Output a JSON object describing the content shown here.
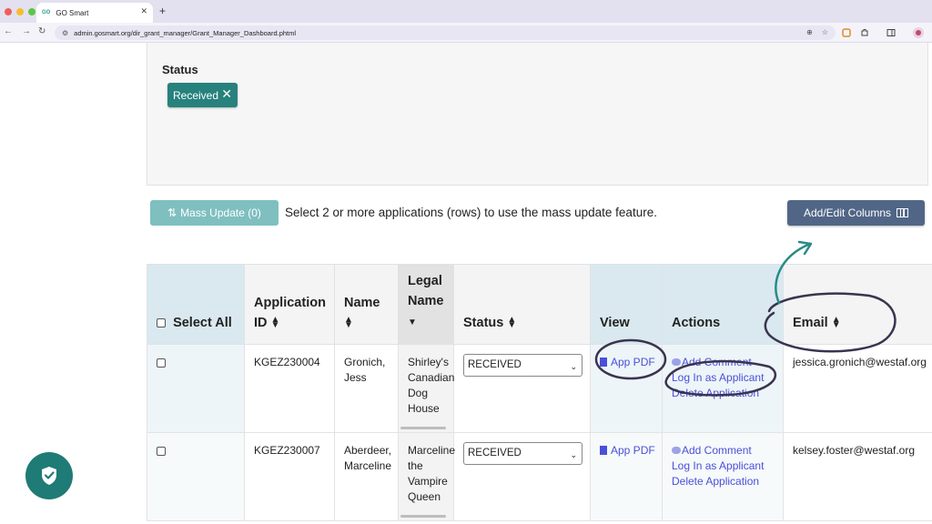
{
  "browser": {
    "tab_title": "GO Smart",
    "favicon_text": "GO",
    "url": "admin.gosmart.org/dir_grant_manager/Grant_Manager_Dashboard.phtml"
  },
  "filter": {
    "status_label": "Status",
    "chip_label": "Received"
  },
  "toolbar": {
    "mass_update_label": "Mass Update (0)",
    "mass_update_hint": "Select 2 or more applications (rows) to use the mass update feature.",
    "add_edit_columns_label": "Add/Edit Columns"
  },
  "table": {
    "headers": {
      "select_all": "Select All",
      "application_id": "Application ID",
      "name": "Name",
      "legal_name": "Legal Name",
      "status": "Status",
      "view": "View",
      "actions": "Actions",
      "email": "Email"
    },
    "rows": [
      {
        "application_id": "KGEZ230004",
        "name": "Gronich, Jess",
        "legal_name": "Shirley's Canadian Dog House",
        "status": "RECEIVED",
        "view": "App PDF",
        "actions": [
          "Add Comment",
          "Log In as Applicant",
          "Delete Application"
        ],
        "email": "jessica.gronich@westaf.org"
      },
      {
        "application_id": "KGEZ230007",
        "name": "Aberdeer, Marceline",
        "legal_name": "Marceline the Vampire Queen",
        "status": "RECEIVED",
        "view": "App PDF",
        "actions": [
          "Add Comment",
          "Log In as Applicant",
          "Delete Application"
        ],
        "email": "kelsey.foster@westaf.org"
      }
    ]
  },
  "colors": {
    "chip": "#27817d",
    "mass_update": "#7fbfc0",
    "add_edit_columns": "#516686",
    "link": "#4a4fd8",
    "annotation": "#3b3350",
    "arrow": "#2a8a86",
    "shield": "#1f7b75"
  },
  "icons": [
    "refresh-arrows-icon",
    "columns-icon",
    "pdf-file-icon",
    "comment-icon",
    "sort-icon",
    "dropdown-chevron-icon",
    "shield-check-icon"
  ]
}
